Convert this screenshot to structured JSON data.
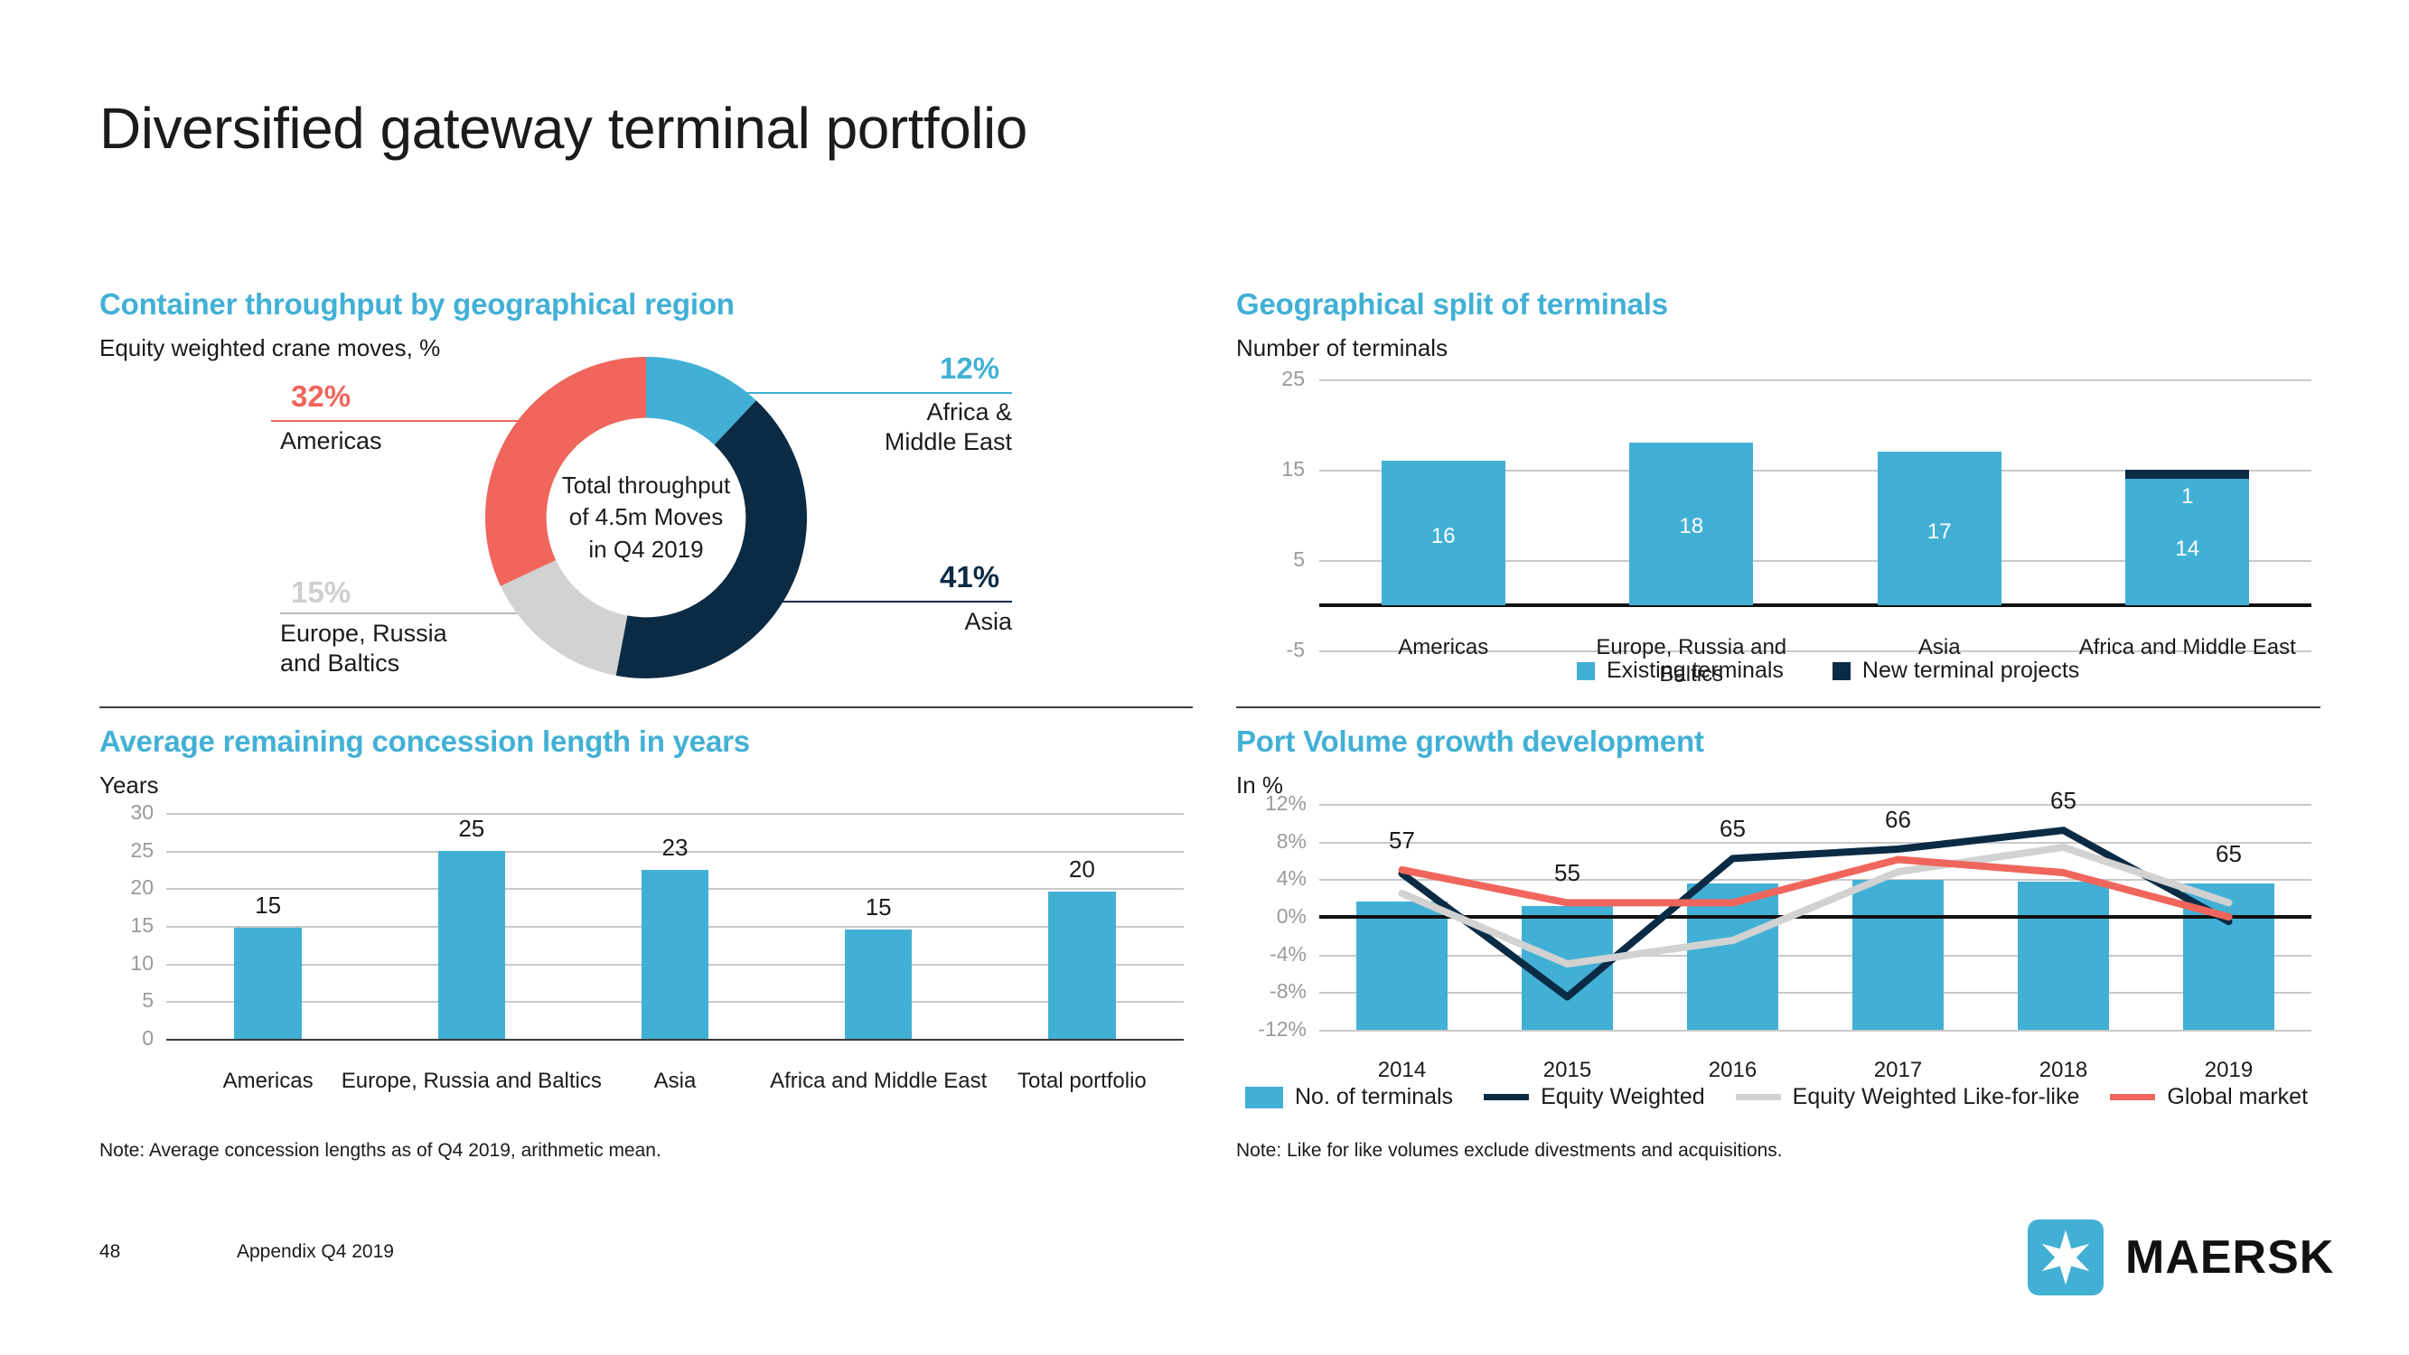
{
  "slide": {
    "title": "Diversified gateway terminal portfolio",
    "footer_page": "48",
    "footer_text": "Appendix Q4 2019",
    "brand": "MAERSK"
  },
  "colors": {
    "accent_blue": "#42b0d5",
    "navy": "#0b2b45",
    "red": "#f0655c",
    "grey": "#d2d2d2"
  },
  "panel_throughput": {
    "title": "Container throughput by geographical region",
    "subtitle": "Equity weighted crane moves, %",
    "center_line1": "Total throughput",
    "center_line2": "of 4.5m Moves",
    "center_line3": "in Q4 2019",
    "chart_data": {
      "type": "pie",
      "title": "Container throughput by geographical region",
      "subtitle": "Equity weighted crane moves, %",
      "unit": "%",
      "center_label": "Total throughput of 4.5m Moves in Q4 2019",
      "labels": [
        "Africa & Middle East",
        "Asia",
        "Europe, Russia and Baltics",
        "Americas"
      ],
      "values": [
        12,
        41,
        15,
        32
      ],
      "value_labels": [
        "12%",
        "41%",
        "15%",
        "32%"
      ],
      "colors": [
        "#42b0d5",
        "#0b2b45",
        "#d2d2d2",
        "#f0655c"
      ],
      "start_angle_deg": 0,
      "donut_hole_ratio": 0.62
    },
    "callouts": [
      {
        "pct": "12%",
        "label": "Africa &\nMiddle East"
      },
      {
        "pct": "41%",
        "label": "Asia"
      },
      {
        "pct": "15%",
        "label": "Europe, Russia\nand Baltics"
      },
      {
        "pct": "32%",
        "label": "Americas"
      }
    ]
  },
  "panel_split": {
    "title": "Geographical split of terminals",
    "subtitle": "Number of terminals",
    "legend": [
      {
        "label": "Existing terminals",
        "color": "#42b0d5"
      },
      {
        "label": "New terminal projects",
        "color": "#0b2b45"
      }
    ],
    "chart_data": {
      "type": "bar",
      "stacked": true,
      "title": "Geographical split of terminals",
      "ylabel": "Number of terminals",
      "xlabel": "",
      "categories": [
        "Americas",
        "Europe, Russia and Baltics",
        "Asia",
        "Africa and Middle East"
      ],
      "ytick_labels": [
        "25",
        "15",
        "5",
        "-5"
      ],
      "ytick_values": [
        25,
        15,
        5,
        -5
      ],
      "ylim": [
        -5,
        25
      ],
      "grid": true,
      "series": [
        {
          "name": "Existing terminals",
          "color": "#42b0d5",
          "values": [
            16,
            18,
            17,
            14
          ]
        },
        {
          "name": "New terminal projects",
          "color": "#0b2b45",
          "values": [
            0,
            0,
            0,
            1
          ]
        }
      ],
      "data_labels": [
        [
          "16",
          "18",
          "17",
          "14"
        ],
        [
          "",
          "",
          "",
          "1"
        ]
      ]
    }
  },
  "panel_concession": {
    "title": "Average remaining concession length in years",
    "subtitle": "Years",
    "note": "Note: Average concession lengths as of Q4 2019, arithmetic mean.",
    "chart_data": {
      "type": "bar",
      "title": "Average remaining concession length in years",
      "ylabel": "Years",
      "xlabel": "",
      "categories": [
        "Americas",
        "Europe, Russia and Baltics",
        "Asia",
        "Africa and Middle East",
        "Total portfolio"
      ],
      "values": [
        15,
        25,
        23,
        15,
        20
      ],
      "data_labels": [
        "15",
        "25",
        "23",
        "15",
        "20"
      ],
      "bar_heights": [
        14.8,
        25.0,
        22.5,
        14.5,
        19.6
      ],
      "ytick_labels": [
        "0",
        "5",
        "10",
        "15",
        "20",
        "25",
        "30"
      ],
      "ytick_values": [
        0,
        5,
        10,
        15,
        20,
        25,
        30
      ],
      "ylim": [
        0,
        30
      ],
      "grid": true,
      "color": "#42b0d5"
    }
  },
  "panel_volume": {
    "title": "Port Volume growth development",
    "subtitle": "In %",
    "note": "Note: Like for like volumes exclude divestments and acquisitions.",
    "legend": [
      {
        "label": "No. of terminals",
        "color": "#42b0d5",
        "kind": "box"
      },
      {
        "label": "Equity Weighted",
        "color": "#0b2b45",
        "kind": "line"
      },
      {
        "label": "Equity Weighted Like-for-like",
        "color": "#d2d2d2",
        "kind": "line"
      },
      {
        "label": "Global market",
        "color": "#f0655c",
        "kind": "line"
      }
    ],
    "chart_data": {
      "type": "line",
      "title": "Port Volume growth development",
      "ylabel": "In %",
      "xlabel": "",
      "categories": [
        "2014",
        "2015",
        "2016",
        "2017",
        "2018",
        "2019"
      ],
      "ytick_labels": [
        "12%",
        "8%",
        "4%",
        "0%",
        "-4%",
        "-8%",
        "-12%"
      ],
      "ytick_values": [
        12,
        8,
        4,
        0,
        -4,
        -8,
        -12
      ],
      "ylim": [
        -12,
        12
      ],
      "grid": true,
      "bar_series": {
        "name": "No. of terminals",
        "color": "#42b0d5",
        "data_labels": [
          "57",
          "55",
          "65",
          "66",
          "65",
          "65"
        ],
        "values": [
          57,
          55,
          65,
          66,
          65,
          65
        ],
        "plotted_pct_heights": [
          1.6,
          1.2,
          3.6,
          3.9,
          3.7,
          3.6
        ]
      },
      "series": [
        {
          "name": "Equity Weighted",
          "color": "#0b2b45",
          "values": [
            4.6,
            -8.5,
            6.2,
            7.2,
            9.2,
            -0.5
          ]
        },
        {
          "name": "Equity Weighted Like-for-like",
          "color": "#d2d2d2",
          "values": [
            2.5,
            -5.0,
            -2.5,
            4.8,
            7.4,
            1.5
          ]
        },
        {
          "name": "Global market",
          "color": "#f0655c",
          "values": [
            5.0,
            1.5,
            1.5,
            6.1,
            4.7,
            0.0
          ]
        }
      ]
    }
  }
}
